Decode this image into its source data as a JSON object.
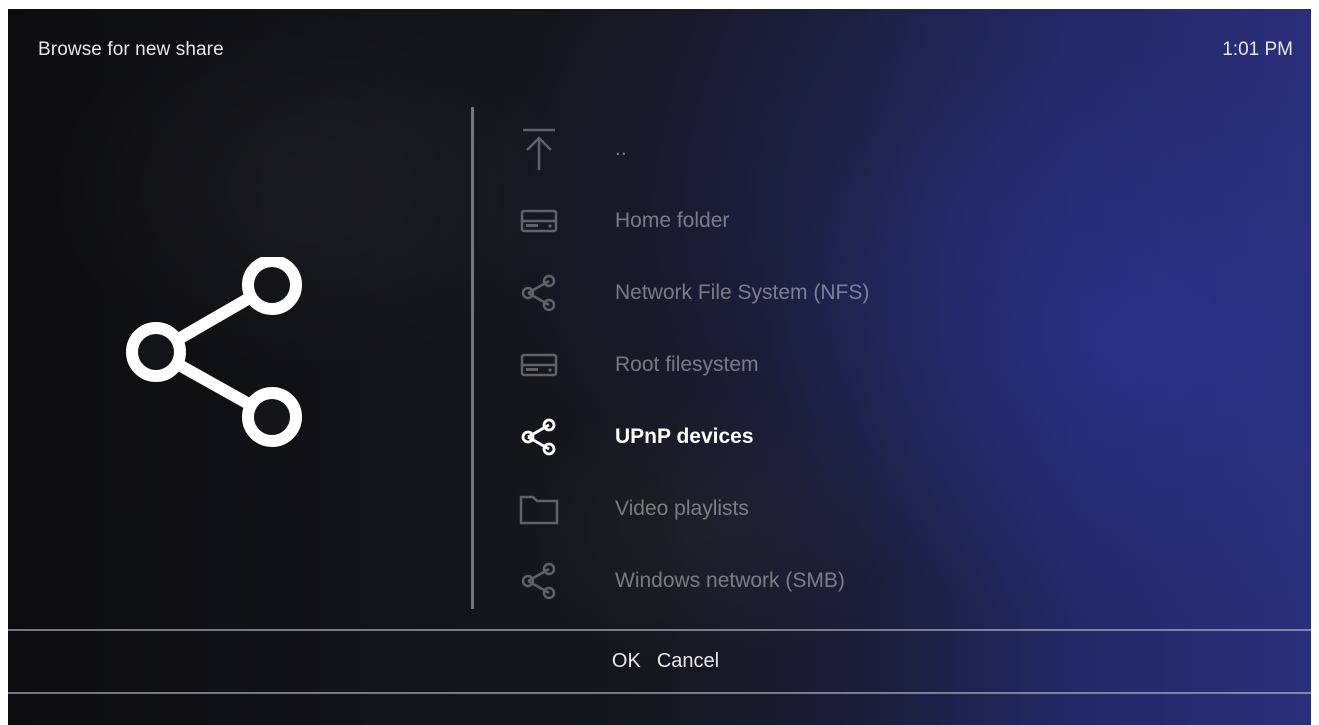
{
  "header": {
    "title": "Browse for new share",
    "clock": "1:01 PM"
  },
  "preview": {
    "icon": "share-icon"
  },
  "list": {
    "items": [
      {
        "label": "..",
        "icon": "up-arrow-icon",
        "selected": false
      },
      {
        "label": "Home folder",
        "icon": "drive-icon",
        "selected": false
      },
      {
        "label": "Network File System (NFS)",
        "icon": "share-icon",
        "selected": false
      },
      {
        "label": "Root filesystem",
        "icon": "drive-icon",
        "selected": false
      },
      {
        "label": "UPnP devices",
        "icon": "share-icon",
        "selected": true
      },
      {
        "label": "Video playlists",
        "icon": "folder-icon",
        "selected": false
      },
      {
        "label": "Windows network (SMB)",
        "icon": "share-icon",
        "selected": false
      }
    ]
  },
  "buttons": {
    "ok_label": "OK",
    "cancel_label": "Cancel"
  },
  "colors": {
    "text_primary": "#ffffff",
    "text_dimmed": "#6b6b6b",
    "background_dark": "#131418",
    "background_accent": "#2a2f7a"
  }
}
